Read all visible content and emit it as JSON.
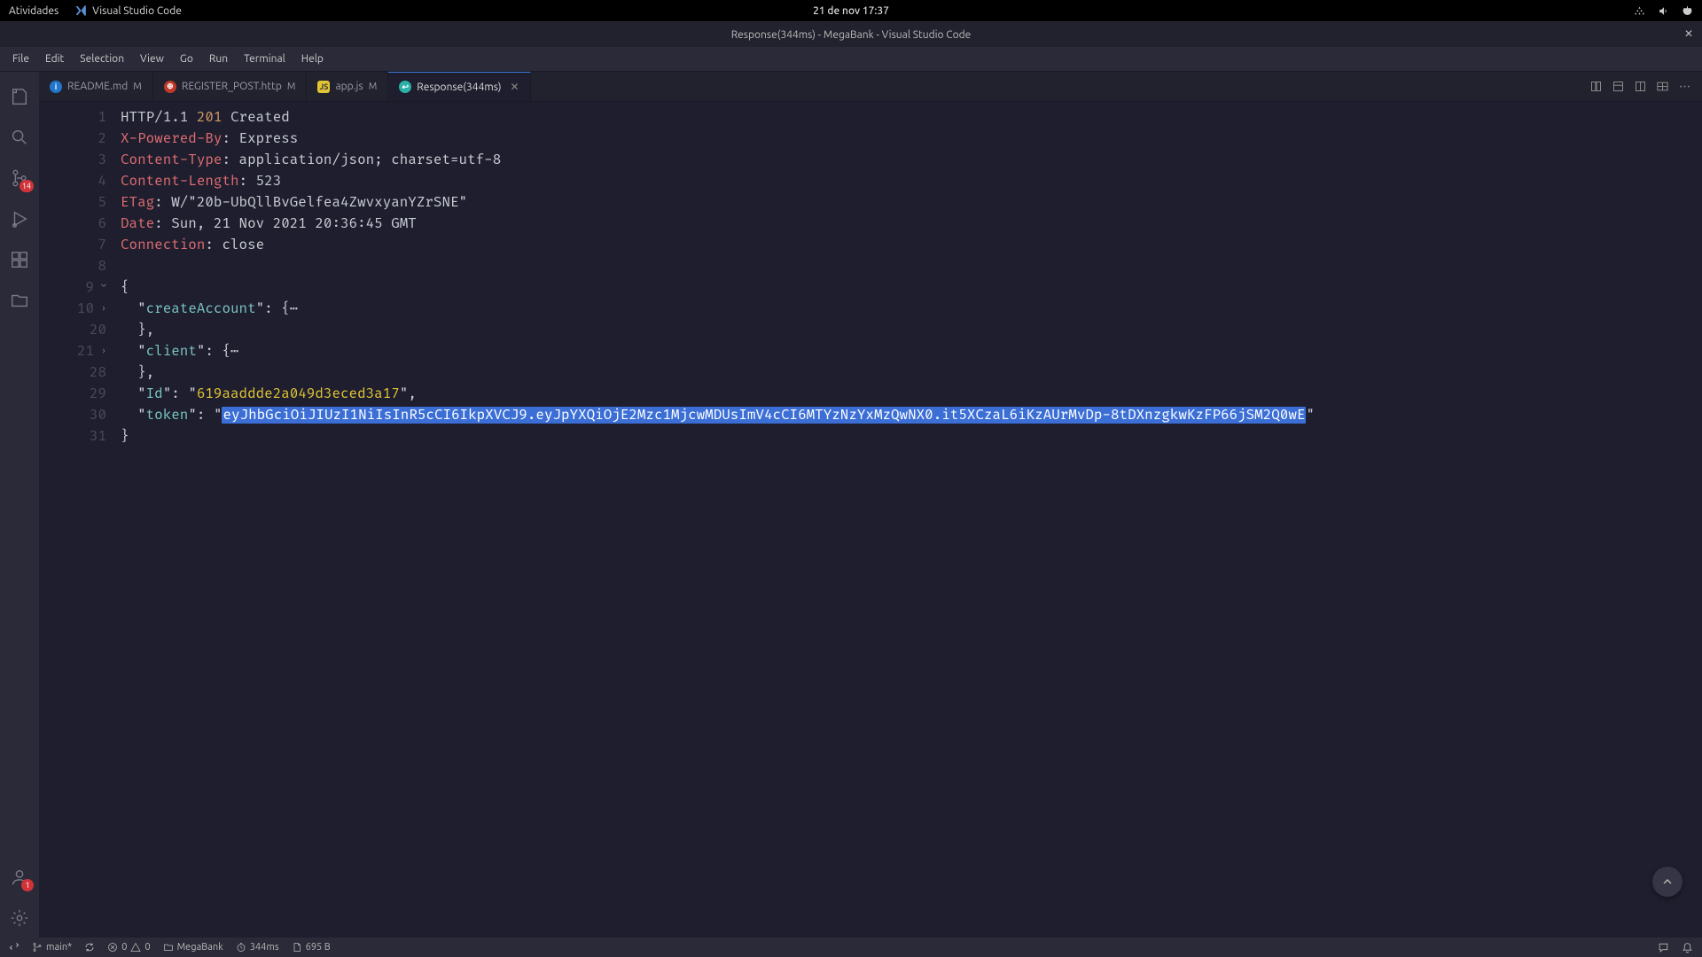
{
  "desktop": {
    "activities": "Atividades",
    "app_name": "Visual Studio Code",
    "clock": "21 de nov  17:37"
  },
  "window": {
    "title": "Response(344ms) - MegaBank - Visual Studio Code"
  },
  "menubar": [
    "File",
    "Edit",
    "Selection",
    "View",
    "Go",
    "Run",
    "Terminal",
    "Help"
  ],
  "activity": {
    "scm_badge": "14",
    "accounts_badge": "1"
  },
  "tabs": [
    {
      "label": "README.md",
      "icon": "blue",
      "glyph": "i",
      "modified": "M"
    },
    {
      "label": "REGISTER_POST.http",
      "icon": "red",
      "glyph": "⊕",
      "modified": "M"
    },
    {
      "label": "app.js",
      "icon": "yellow",
      "glyph": "JS",
      "modified": "M"
    },
    {
      "label": "Response(344ms)",
      "icon": "cyan",
      "glyph": "↩",
      "modified": ""
    }
  ],
  "code": {
    "l1": {
      "a": "HTTP/1.1 ",
      "b": "201",
      "c": " Created"
    },
    "l2": {
      "a": "X-Powered-By",
      "b": ": Express"
    },
    "l3": {
      "a": "Content-Type",
      "b": ": application/json; charset=utf-8"
    },
    "l4": {
      "a": "Content-Length",
      "b": ": 523"
    },
    "l5": {
      "a": "ETag",
      "b": ": W/\"20b-UbQllBvGelfea4ZwvxyanYZrSNE\""
    },
    "l6": {
      "a": "Date",
      "b": ": Sun, 21 Nov 2021 20:36:45 GMT"
    },
    "l7": {
      "a": "Connection",
      "b": ": close"
    },
    "l9": "{",
    "l10": {
      "pre": "  \"",
      "key": "createAccount",
      "post": "\": {⋯"
    },
    "l20": "  },",
    "l21": {
      "pre": "  \"",
      "key": "client",
      "post": "\": {⋯"
    },
    "l28": "  },",
    "l29": {
      "pre": "  \"",
      "key": "Id",
      "mid": "\": \"",
      "val": "619aaddde2a049d3eced3a17",
      "post": "\","
    },
    "l30": {
      "pre": "  \"",
      "key": "token",
      "mid": "\": \"",
      "tok": "eyJhbGciOiJIUzI1NiIsInR5cCI6IkpXVCJ9.eyJpYXQiOjE2Mzc1MjcwMDUsImV4cCI6MTYzNzYxMzQwNX0.it5XCzaL6iKzAUrMvDp-8tDXnzgkwKzFP66jSM2Q0wE",
      "post": "\""
    },
    "l31": "}"
  },
  "linenumbers": {
    "l1": "1",
    "l2": "2",
    "l3": "3",
    "l4": "4",
    "l5": "5",
    "l6": "6",
    "l7": "7",
    "l8": "8",
    "l9": "9",
    "l10": "10",
    "l20": "20",
    "l21": "21",
    "l28": "28",
    "l29": "29",
    "l30": "30",
    "l30b": "",
    "l31": "31"
  },
  "statusbar": {
    "branch": "main*",
    "errors": "0",
    "warnings": "0",
    "project": "MegaBank",
    "timing": "344ms",
    "size": "695 B"
  }
}
